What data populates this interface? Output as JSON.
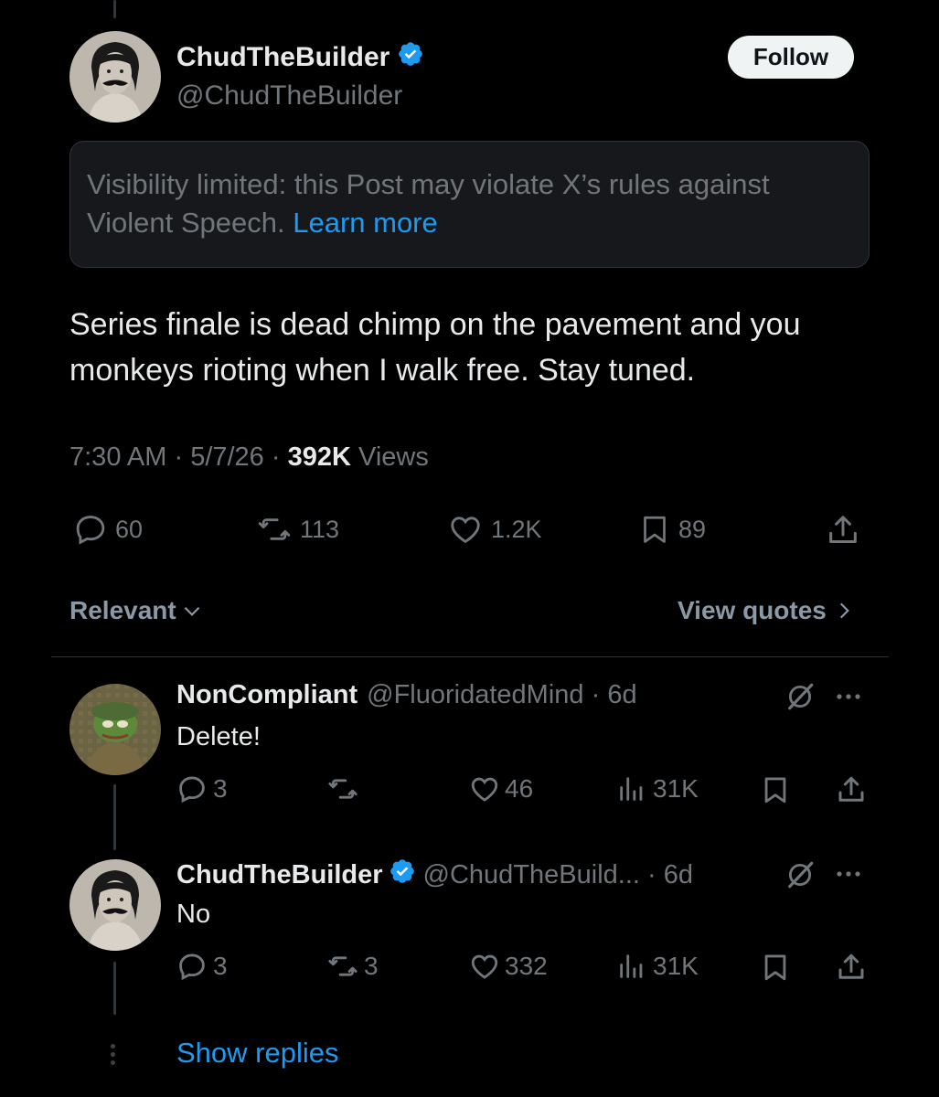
{
  "tweet": {
    "author_name": "ChudTheBuilder",
    "author_handle": "@ChudTheBuilder",
    "follow_label": "Follow",
    "notice_text": "Visibility limited: this Post may violate X’s rules against Violent Speech.",
    "notice_link": "Learn more",
    "text": "Series finale is dead chimp on the pavement and you monkeys rioting when I walk free. Stay tuned.",
    "time": "7:30 AM",
    "date": "5/7/26",
    "views_count": "392K",
    "views_label": "Views",
    "stats": {
      "replies": "60",
      "reposts": "113",
      "likes": "1.2K",
      "bookmarks": "89"
    }
  },
  "filters": {
    "sort_label": "Relevant",
    "quotes_label": "View quotes"
  },
  "replies": [
    {
      "name": "NonCompliant",
      "handle": "@FluoridatedMind",
      "time": "6d",
      "text": "Delete!",
      "stats": {
        "replies": "3",
        "reposts": "",
        "likes": "46",
        "views": "31K"
      }
    },
    {
      "name": "ChudTheBuilder",
      "handle": "@ChudTheBuild...",
      "time": "6d",
      "text": "No",
      "stats": {
        "replies": "3",
        "reposts": "3",
        "likes": "332",
        "views": "31K"
      }
    }
  ],
  "show_replies_label": "Show replies",
  "colors": {
    "background": "#000000",
    "accent": "#1d9bf0",
    "muted": "#71767b",
    "text": "#e7e9ea"
  },
  "icons": [
    "verified-badge-icon",
    "reply-icon",
    "repost-icon",
    "like-icon",
    "bookmark-icon",
    "share-icon",
    "views-icon",
    "grok-icon",
    "more-icon",
    "chevron-down-icon",
    "chevron-right-icon"
  ]
}
